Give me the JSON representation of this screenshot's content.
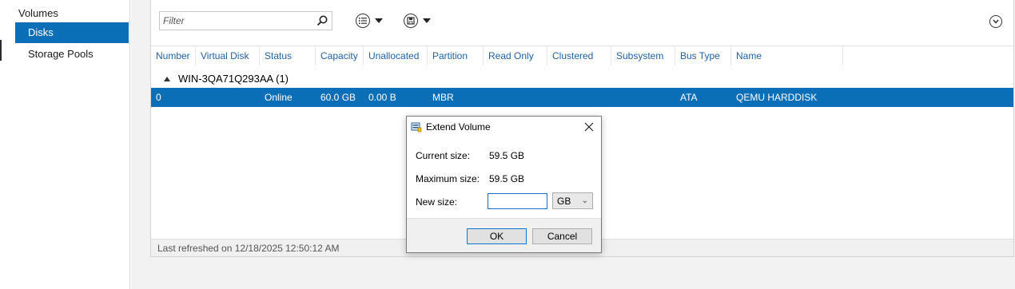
{
  "nav": {
    "items": [
      {
        "label": "Volumes"
      },
      {
        "label": "Disks",
        "selected": true
      },
      {
        "label": "Storage Pools"
      }
    ]
  },
  "toolbar": {
    "filter_placeholder": "Filter",
    "icons": [
      "search-icon",
      "list-view-icon",
      "save-query-icon",
      "expand-icon"
    ]
  },
  "table": {
    "columns": [
      "Number",
      "Virtual Disk",
      "Status",
      "Capacity",
      "Unallocated",
      "Partition",
      "Read Only",
      "Clustered",
      "Subsystem",
      "Bus Type",
      "Name"
    ],
    "group_label": "WIN-3QA71Q293AA (1)",
    "rows": [
      {
        "number": "0",
        "virtual_disk": "",
        "status": "Online",
        "capacity": "60.0 GB",
        "unallocated": "0.00 B",
        "partition": "MBR",
        "read_only": "",
        "clustered": "",
        "subsystem": "",
        "bus_type": "ATA",
        "name": "QEMU HARDDISK"
      }
    ]
  },
  "status_bar": {
    "text": "Last refreshed on 12/18/2025 12:50:12 AM"
  },
  "dialog": {
    "title": "Extend Volume",
    "current_size_label": "Current size:",
    "current_size_value": "59.5 GB",
    "max_size_label": "Maximum size:",
    "max_size_value": "59.5 GB",
    "new_size_label": "New size:",
    "new_size_value": "",
    "unit": "GB",
    "ok_label": "OK",
    "cancel_label": "Cancel"
  },
  "colors": {
    "accent": "#0b6fb8",
    "header_text": "#1f5f9e"
  }
}
